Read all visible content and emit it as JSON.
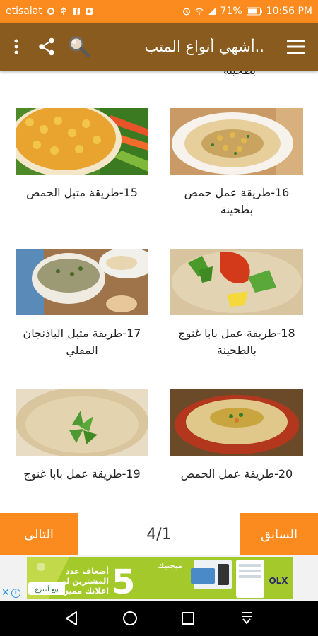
{
  "status_bar": {
    "carrier": "etisalat",
    "battery": "71%",
    "time": "10:56 PM"
  },
  "app_bar": {
    "title": "أشهي أنواع المتب.."
  },
  "cut_off_text": "بطحينة",
  "cards": [
    {
      "label": "15-طريقة متبل الحمص"
    },
    {
      "label": "16-طريقة عمل حمص بطحينة"
    },
    {
      "label": "17-طريقة متبل الباذنجان المقلي"
    },
    {
      "label": "18-طريقة عمل بابا غنوج بالطحينة"
    },
    {
      "label": "19-طريقة عمل بابا غنوج"
    },
    {
      "label": "20-طريقة عمل الحمص"
    }
  ],
  "pager": {
    "next_label": "التالى",
    "prev_label": "السابق",
    "page_count": "4/1"
  },
  "ad": {
    "number": "5",
    "line1": "أضعاف عدد",
    "line2": "المشترين لو",
    "line3": "اعلانك مميز",
    "brand": "ميجنيك",
    "cta": "بيع أسرع",
    "logo": "OLX"
  },
  "colors": {
    "status_bar": "#fb8b1e",
    "app_bar": "#8a5b1f",
    "accent": "#fb8b1e"
  }
}
